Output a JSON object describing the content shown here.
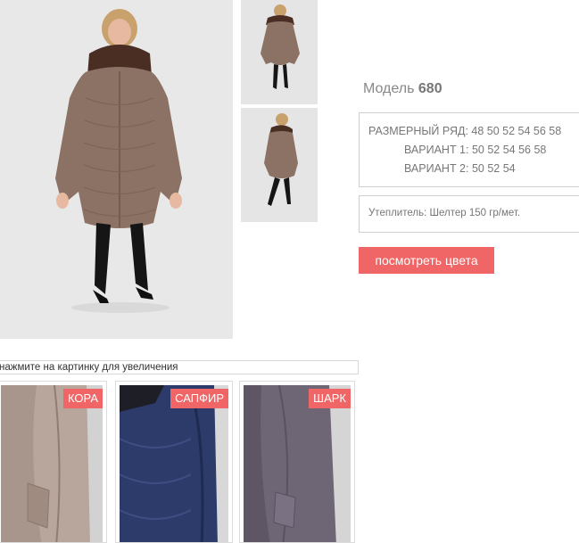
{
  "product": {
    "model_label": "Модель",
    "model_number": "680",
    "size_row_label": "РАЗМЕРНЫЙ РЯД:",
    "size_row_values": "48 50 52 54 56 58",
    "variant1_label": "ВАРИАНТ 1:",
    "variant1_values": "50 52 54 56 58",
    "variant2_label": "ВАРИАНТ 2:",
    "variant2_values": "50 52 54",
    "insulation": "Утеплитель: Шелтер 150 гр/мет.",
    "colors_button": "посмотреть цвета"
  },
  "hint": "нажмите на картинку для увеличения",
  "color_cards": [
    {
      "label": "КОРА",
      "color": "#a08b80"
    },
    {
      "label": "САПФИР",
      "color": "#2d3b6b"
    },
    {
      "label": "ШАРК",
      "color": "#6e6575"
    }
  ],
  "colors": {
    "accent": "#f06565",
    "coat_main": "#8b7264"
  }
}
